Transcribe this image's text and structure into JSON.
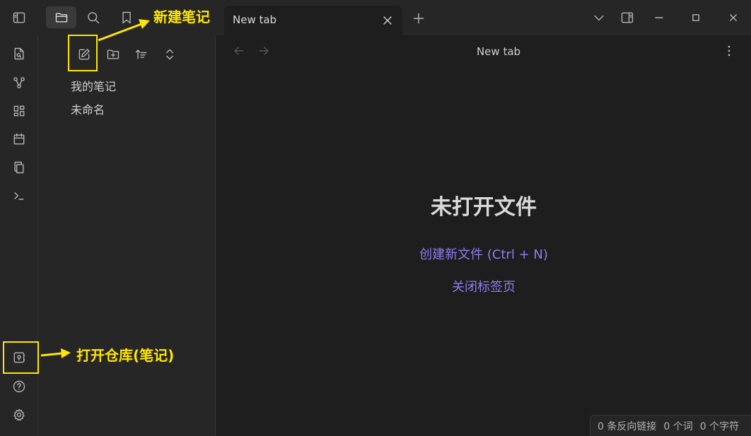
{
  "titlebar": {
    "tab_title": "New tab",
    "window_controls": [
      "minimize",
      "maximize",
      "close"
    ]
  },
  "sidebar": {
    "files": [
      "我的笔记",
      "未命名"
    ]
  },
  "main": {
    "nav_title": "New tab",
    "empty_title": "未打开文件",
    "create_link": "创建新文件 (Ctrl + N)",
    "close_link": "关闭标签页"
  },
  "status": {
    "backlinks": "0 条反向链接",
    "words": "0 个词",
    "chars": "0 个字符"
  },
  "annotations": {
    "new_note": "新建笔记",
    "open_vault": "打开仓库(笔记)"
  },
  "colors": {
    "accent": "#8e7cf0",
    "highlight": "#ffe600",
    "background": "#1e1e1e",
    "panel": "#262626"
  }
}
